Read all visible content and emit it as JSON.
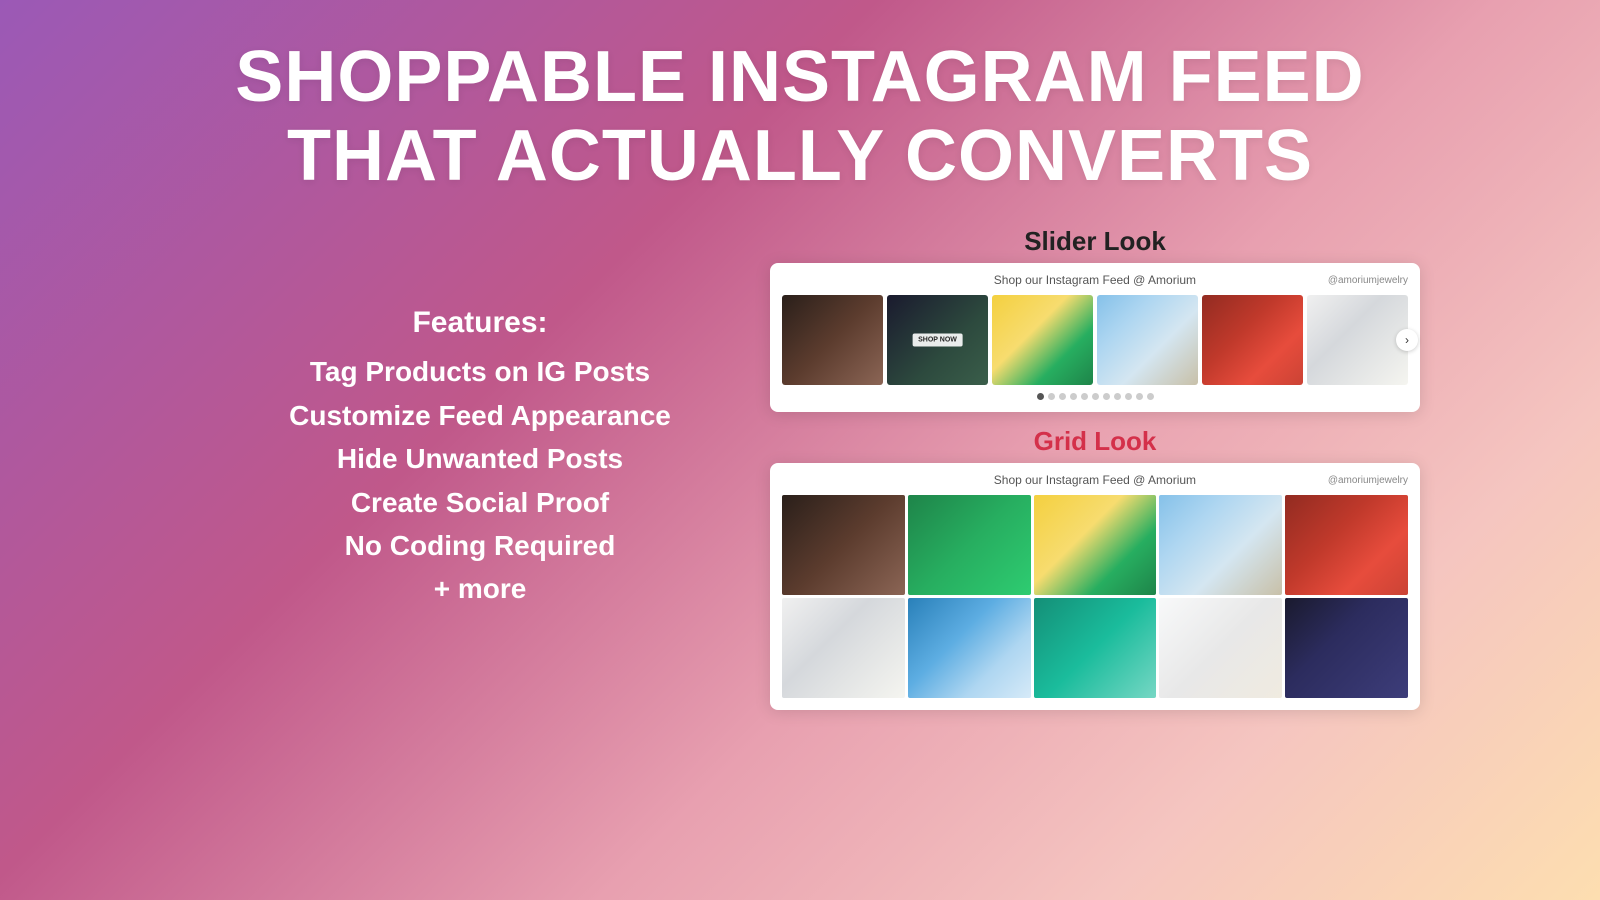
{
  "header": {
    "line1": "SHOPPABLE INSTAGRAM FEED",
    "line2": "THAT ACTUALLY CONVERTS"
  },
  "features": {
    "title": "Features:",
    "items": [
      "Tag Products on IG Posts",
      "Customize Feed Appearance",
      "Hide Unwanted Posts",
      "Create Social Proof",
      "No Coding Required",
      "+ more"
    ]
  },
  "slider_section": {
    "label": "Slider Look",
    "feed_title": "Shop our Instagram Feed @ Amorium",
    "handle": "@amoriumjewelry",
    "dots_count": 11,
    "active_dot": 0
  },
  "grid_section": {
    "label": "Grid Look",
    "feed_title": "Shop our Instagram Feed @ Amorium",
    "handle": "@amoriumjewelry"
  }
}
